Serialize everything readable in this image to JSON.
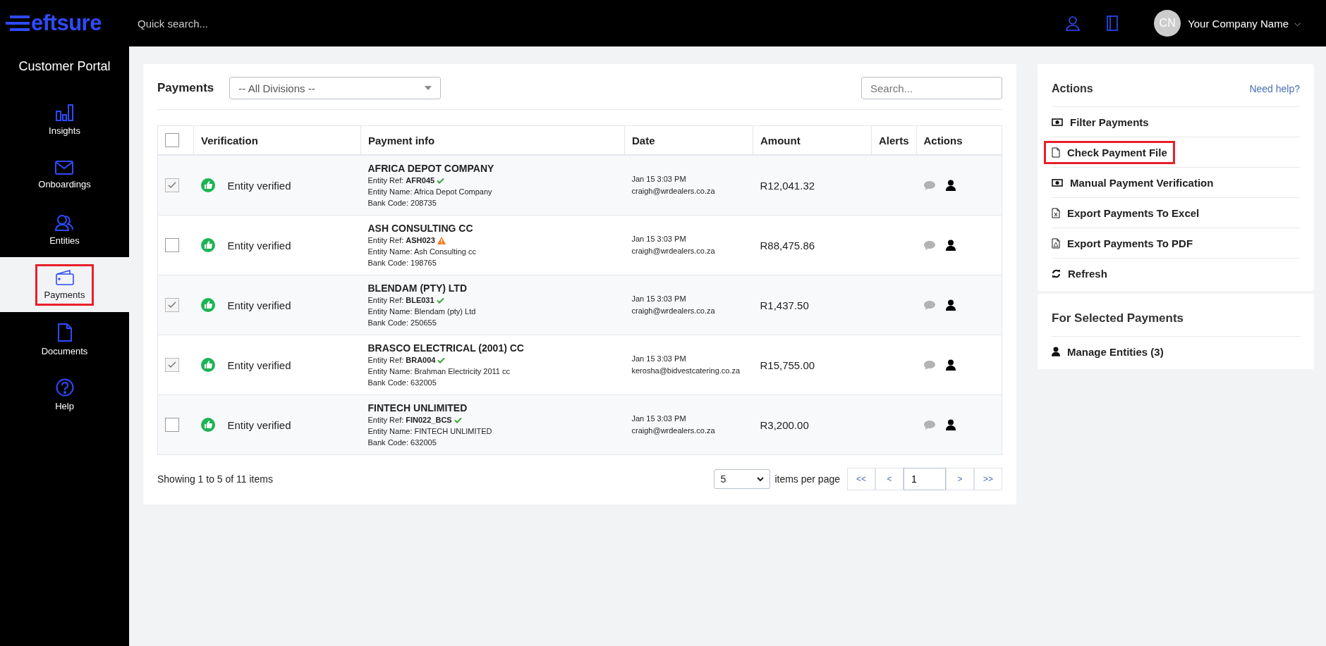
{
  "header": {
    "logo": "eftsure",
    "search": {
      "placeholder": "Quick search..."
    },
    "avatar": "CN",
    "company": "Your Company Name",
    "caret": "⌵"
  },
  "sidebar": {
    "title": "Customer Portal",
    "items": [
      {
        "label": "Insights",
        "kind": "chart",
        "selected": false,
        "highlighted": false
      },
      {
        "label": "Onboardings",
        "kind": "mail",
        "selected": false,
        "highlighted": false
      },
      {
        "label": "Entities",
        "kind": "people",
        "selected": false,
        "highlighted": false
      },
      {
        "label": "Payments",
        "kind": "wallet",
        "selected": true,
        "highlighted": true
      },
      {
        "label": "Documents",
        "kind": "doc",
        "selected": false,
        "highlighted": false
      },
      {
        "label": "Help",
        "kind": "help",
        "selected": false,
        "highlighted": false
      }
    ]
  },
  "payments": {
    "title": "Payments",
    "division": {
      "value": "-- All Divisions --"
    },
    "search": {
      "placeholder": "Search..."
    },
    "table": {
      "all_checked": false,
      "columns": [
        "Verification",
        "Payment info",
        "Date",
        "Amount",
        "Alerts",
        "Actions"
      ],
      "rows": [
        {
          "checked": true,
          "verification": "Entity verified",
          "name": "AFRICA DEPOT COMPANY",
          "ref_label": "Entity Ref:",
          "ref": {
            "text": "AFR045",
            "kind": "ok"
          },
          "entity_name": "Entity Name: Africa Depot Company",
          "bank_code": "Bank Code: 208735",
          "date": "Jan 15 3:03 PM",
          "email": "craigh@wrdealers.co.za",
          "amount": "R12,041.32"
        },
        {
          "checked": false,
          "verification": "Entity verified",
          "name": "ASH CONSULTING CC",
          "ref_label": "Entity Ref:",
          "ref": {
            "text": "ASH023",
            "kind": "warning"
          },
          "entity_name": "Entity Name: Ash Consulting cc",
          "bank_code": "Bank Code: 198765",
          "date": "Jan 15 3:03 PM",
          "email": "craigh@wrdealers.co.za",
          "amount": "R88,475.86"
        },
        {
          "checked": true,
          "verification": "Entity verified",
          "name": "BLENDAM (PTY) LTD",
          "ref_label": "Entity Ref:",
          "ref": {
            "text": "BLE031",
            "kind": "ok"
          },
          "entity_name": "Entity Name: Blendam (pty) Ltd",
          "bank_code": "Bank Code: 250655",
          "date": "Jan 15 3:03 PM",
          "email": "craigh@wrdealers.co.za",
          "amount": "R1,437.50"
        },
        {
          "checked": true,
          "verification": "Entity verified",
          "name": "BRASCO ELECTRICAL (2001) CC",
          "ref_label": "Entity Ref:",
          "ref": {
            "text": "BRA004",
            "kind": "ok"
          },
          "entity_name": "Entity Name: Brahman Electricity 2011 cc",
          "bank_code": "Bank Code: 632005",
          "date": "Jan 15 3:03 PM",
          "email": "kerosha@bidvestcatering.co.za",
          "amount": "R15,755.00"
        },
        {
          "checked": false,
          "verification": "Entity verified",
          "name": "FINTECH UNLIMITED",
          "ref_label": "Entity Ref:",
          "ref": {
            "text": "FIN022_BCS",
            "kind": "ok"
          },
          "entity_name": "Entity Name: FINTECH UNLIMITED",
          "bank_code": "Bank Code: 632005",
          "date": "Jan 15 3:03 PM",
          "email": "craigh@wrdealers.co.za",
          "amount": "R3,200.00"
        }
      ]
    },
    "summary": "Showing 1 to 5 of 11 items",
    "page_size": "5",
    "page_size_label": "items per page",
    "pager": {
      "first": "<<",
      "prev": "<",
      "page": "1",
      "next": ">",
      "last": ">>"
    }
  },
  "actions": {
    "title": "Actions",
    "help": "Need help?",
    "items": [
      {
        "label": "Filter Payments",
        "kind": "money",
        "highlighted": false
      },
      {
        "label": "Check Payment File",
        "kind": "file",
        "highlighted": true
      },
      {
        "label": "Manual Payment Verification",
        "kind": "money",
        "highlighted": false
      },
      {
        "label": "Export Payments To Excel",
        "kind": "excel",
        "highlighted": false
      },
      {
        "label": "Export Payments To PDF",
        "kind": "pdf",
        "highlighted": false
      },
      {
        "label": "Refresh",
        "kind": "refresh",
        "highlighted": false
      }
    ]
  },
  "selected_actions": {
    "title": "For Selected Payments",
    "items": [
      {
        "label": "Manage Entities (3)",
        "kind": "user",
        "highlighted": false
      }
    ]
  }
}
